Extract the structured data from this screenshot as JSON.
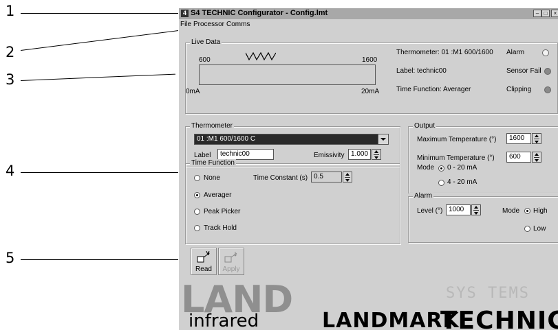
{
  "callouts": [
    "1",
    "2",
    "3",
    "4",
    "5"
  ],
  "window": {
    "icon": "4",
    "title": "S4 TECHNIC Configurator - Config.lmt",
    "controls": [
      "minimize-icon",
      "maximize-icon",
      "close-icon"
    ]
  },
  "menu": [
    "File",
    "Processor",
    "Comms"
  ],
  "live_data": {
    "title": "Live Data",
    "scale_min": "600",
    "scale_max": "1600",
    "current_min": "0mA",
    "current_max": "20mA",
    "thermometer": "Thermometer: 01 :M1  600/1600",
    "label": "Label: technic00",
    "time_function": "Time Function: Averager",
    "alarm": "Alarm",
    "sensor_fail": "Sensor Fail",
    "clipping": "Clipping",
    "colors": {
      "alarm_led": "#f2f2f2",
      "status_led": "#8a8a8a"
    }
  },
  "thermometer": {
    "title": "Thermometer",
    "selected": "01 :M1  600/1600 C",
    "label_caption": "Label",
    "label_value": "technic00",
    "emissivity_caption": "Emissivity",
    "emissivity_value": "1.000"
  },
  "time_function": {
    "title": "Time Function",
    "options": [
      "None",
      "Averager",
      "Peak Picker",
      "Track Hold"
    ],
    "selected": "Averager",
    "constant_caption": "Time Constant (s)",
    "constant_value": "0.5"
  },
  "output": {
    "title": "Output",
    "max_caption": "Maximum Temperature (°)",
    "max_value": "1600",
    "min_caption": "Minimum Temperature (°)",
    "min_value": "600",
    "mode_caption": "Mode",
    "mode_options": [
      "0 - 20 mA",
      "4 - 20 mA"
    ],
    "mode_selected": "0 - 20 mA"
  },
  "alarm": {
    "title": "Alarm",
    "level_caption": "Level (°)",
    "level_value": "1000",
    "mode_caption": "Mode",
    "mode_options": [
      "High",
      "Low"
    ],
    "mode_selected": "High"
  },
  "toolbar": {
    "read_label": "Read",
    "apply_label": "Apply"
  },
  "branding": {
    "land": "LAND",
    "infrared": "infrared",
    "landmark": "LANDMARK",
    "technic": "TECHNIC",
    "ghost": "SYS TEMS"
  }
}
